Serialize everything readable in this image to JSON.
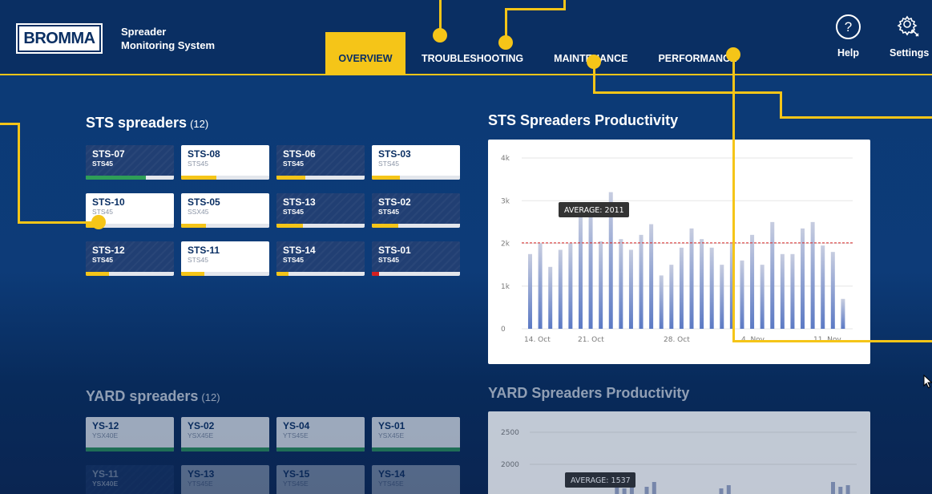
{
  "header": {
    "logo": "BROMMA",
    "title_line1": "Spreader",
    "title_line2": "Monitoring System",
    "tabs": [
      {
        "label": "OVERVIEW",
        "active": true
      },
      {
        "label": "TROUBLESHOOTING",
        "active": false
      },
      {
        "label": "MAINTENANCE",
        "active": false
      },
      {
        "label": "PERFORMANCE",
        "active": false
      }
    ],
    "help_label": "Help",
    "help_icon": "question-mark-icon",
    "settings_label": "Settings",
    "settings_icon": "gear-wrench-icon"
  },
  "sts": {
    "title": "STS spreaders",
    "count": "(12)",
    "cards": [
      {
        "name": "STS-07",
        "type": "STS45",
        "style": "dark",
        "level": 0.68,
        "color": "#2e9e57"
      },
      {
        "name": "STS-08",
        "type": "STS45",
        "style": "light",
        "level": 0.4,
        "color": "#f5c518"
      },
      {
        "name": "STS-06",
        "type": "STS45",
        "style": "dark",
        "level": 0.33,
        "color": "#f5c518"
      },
      {
        "name": "STS-03",
        "type": "STS45",
        "style": "light",
        "level": 0.32,
        "color": "#f5c518"
      },
      {
        "name": "STS-10",
        "type": "STS45",
        "style": "light",
        "level": 0.2,
        "color": "#f5c518"
      },
      {
        "name": "STS-05",
        "type": "SSX45",
        "style": "light",
        "level": 0.28,
        "color": "#f5c518"
      },
      {
        "name": "STS-13",
        "type": "STS45",
        "style": "dark",
        "level": 0.3,
        "color": "#f5c518"
      },
      {
        "name": "STS-02",
        "type": "STS45",
        "style": "dark",
        "level": 0.3,
        "color": "#f5c518"
      },
      {
        "name": "STS-12",
        "type": "STS45",
        "style": "dark",
        "level": 0.26,
        "color": "#f5c518"
      },
      {
        "name": "STS-11",
        "type": "STS45",
        "style": "light",
        "level": 0.26,
        "color": "#f5c518"
      },
      {
        "name": "STS-14",
        "type": "STS45",
        "style": "dark",
        "level": 0.14,
        "color": "#f5c518"
      },
      {
        "name": "STS-01",
        "type": "STS45",
        "style": "dark",
        "level": 0.08,
        "color": "#d62020"
      }
    ]
  },
  "yard": {
    "title": "YARD spreaders",
    "count": "(12)",
    "cards": [
      {
        "name": "YS-12",
        "type": "YSX40E",
        "style": "light",
        "level": 1.0,
        "color": "#2e9e57"
      },
      {
        "name": "YS-02",
        "type": "YSX45E",
        "style": "light",
        "level": 1.0,
        "color": "#2e9e57"
      },
      {
        "name": "YS-04",
        "type": "YTS45E",
        "style": "light",
        "level": 1.0,
        "color": "#2e9e57"
      },
      {
        "name": "YS-01",
        "type": "YSX45E",
        "style": "light",
        "level": 1.0,
        "color": "#2e9e57"
      },
      {
        "name": "YS-11",
        "type": "YSX40E",
        "style": "dark",
        "level": 0,
        "color": "#2e9e57"
      },
      {
        "name": "YS-13",
        "type": "YTS45E",
        "style": "light",
        "level": 0,
        "color": "#2e9e57"
      },
      {
        "name": "YS-15",
        "type": "YTS45E",
        "style": "light",
        "level": 0,
        "color": "#2e9e57"
      },
      {
        "name": "YS-14",
        "type": "YTS45E",
        "style": "light",
        "level": 0,
        "color": "#2e9e57"
      }
    ]
  },
  "charts": {
    "sts_title": "STS Spreaders Productivity",
    "yard_title": "YARD Spreaders Productivity"
  },
  "chart_data": [
    {
      "type": "bar",
      "title": "STS Spreaders Productivity",
      "ylim": [
        0,
        4000
      ],
      "yticks": [
        "0",
        "1k",
        "2k",
        "3k",
        "4k"
      ],
      "xticks": [
        "14. Oct",
        "21. Oct",
        "28. Oct",
        "4. Nov",
        "11. Nov"
      ],
      "values": [
        1750,
        2000,
        1450,
        1850,
        2000,
        2700,
        2900,
        2050,
        3200,
        2100,
        1850,
        2200,
        2450,
        1250,
        1500,
        1900,
        2350,
        2100,
        1900,
        1500,
        2000,
        1600,
        2200,
        1500,
        2500,
        1750,
        1750,
        2350,
        2500,
        1950,
        1800,
        700
      ],
      "average": 2011,
      "average_label": "AVERAGE: 2011",
      "bar_color": "#5b79c4",
      "average_line_color": "#d62020"
    },
    {
      "type": "bar",
      "title": "YARD Spreaders Productivity",
      "yticks": [
        "2000",
        "2500"
      ],
      "average": 1537,
      "average_label": "AVERAGE: 1537"
    }
  ]
}
